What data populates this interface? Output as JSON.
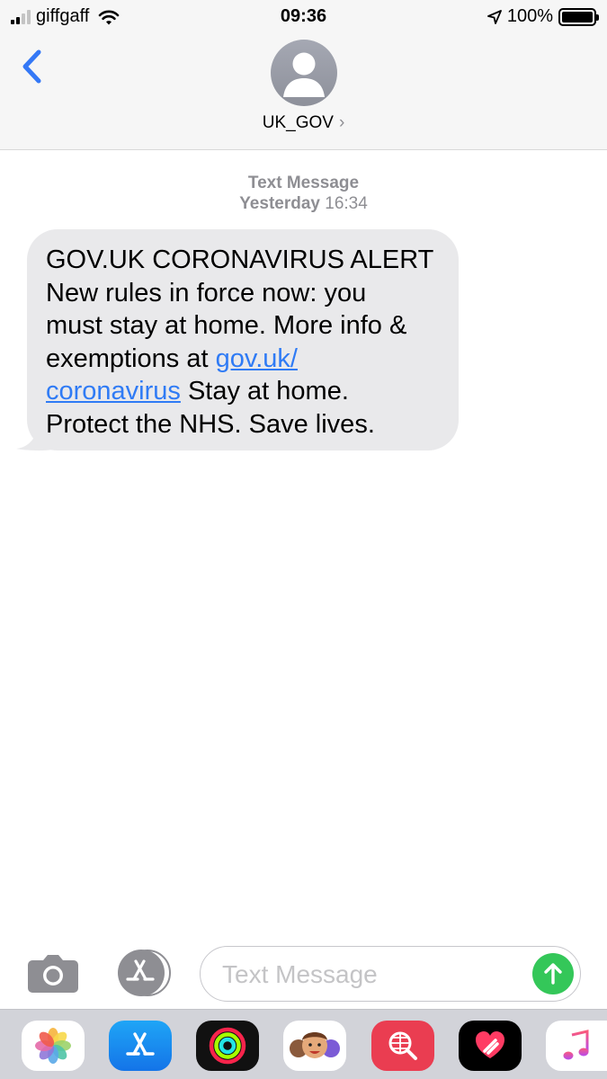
{
  "status_bar": {
    "carrier": "giffgaff",
    "time": "09:36",
    "battery_percent": "100%",
    "battery_level": 1.0,
    "signal_bars": 2
  },
  "header": {
    "contact_name": "UK_GOV",
    "chevron": "›"
  },
  "conversation": {
    "service_label": "Text Message",
    "day_label": "Yesterday",
    "time_label": "16:34",
    "message": {
      "line1": "GOV.UK CORONAVIRUS ALERT",
      "line2": "New rules in force now: you",
      "line3": "must stay at home. More info &",
      "line4_prefix": "exemptions at ",
      "link_part1": "gov.uk/",
      "link_part2": "coronavirus",
      "line5_suffix": " Stay at home.",
      "line6": "Protect the NHS. Save lives."
    }
  },
  "input_bar": {
    "placeholder": "Text Message"
  },
  "icons": {
    "back": "chevron-left-icon",
    "camera": "camera-icon",
    "apps": "app-store-icon",
    "send": "arrow-up-icon",
    "location": "location-arrow-icon",
    "wifi": "wifi-icon"
  },
  "app_drawer": [
    "photos",
    "app-store",
    "activity",
    "memoji",
    "web-search",
    "digital-touch",
    "music"
  ],
  "colors": {
    "link": "#2f7bf5",
    "back_chevron": "#3478f6",
    "send": "#34c759",
    "bubble": "#e9e9eb",
    "meta_text": "#8e8e93"
  }
}
